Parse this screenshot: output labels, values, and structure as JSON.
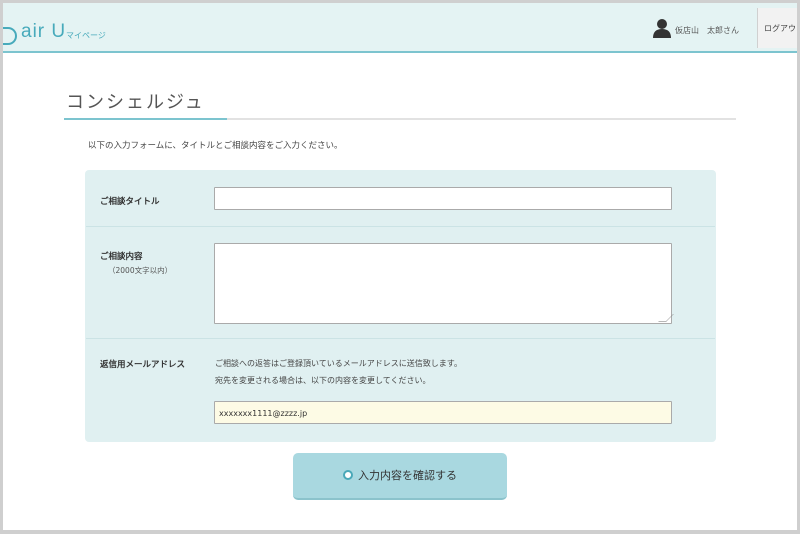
{
  "header": {
    "logo_text": "air U",
    "logo_sub": "マイページ",
    "user_name": "仮店山　太郎さん",
    "logout_label": "ログアウト"
  },
  "page": {
    "title": "コンシェルジュ",
    "intro": "以下の入力フォームに、タイトルとご相談内容をご入力ください。"
  },
  "form": {
    "title_label": "ご相談タイトル",
    "title_value": "",
    "body_label": "ご相談内容",
    "body_note": "（2000文字以内）",
    "body_value": "",
    "email_label": "返信用メールアドレス",
    "email_note_1": "ご相談への返答はご登録頂いているメールアドレスに送信致します。",
    "email_note_2": "宛先を変更される場合は、以下の内容を変更してください。",
    "email_value": "xxxxxxx1111@zzzz.jp"
  },
  "actions": {
    "confirm_label": "入力内容を確認する"
  },
  "colors": {
    "accent": "#47aabb",
    "header_bg": "#e4f3f3",
    "panel_bg": "#e0f0f1",
    "button_bg": "#a9d8e0"
  },
  "icons": {
    "user": "user-icon",
    "logo": "logo-mark-icon",
    "button": "circle-icon"
  }
}
